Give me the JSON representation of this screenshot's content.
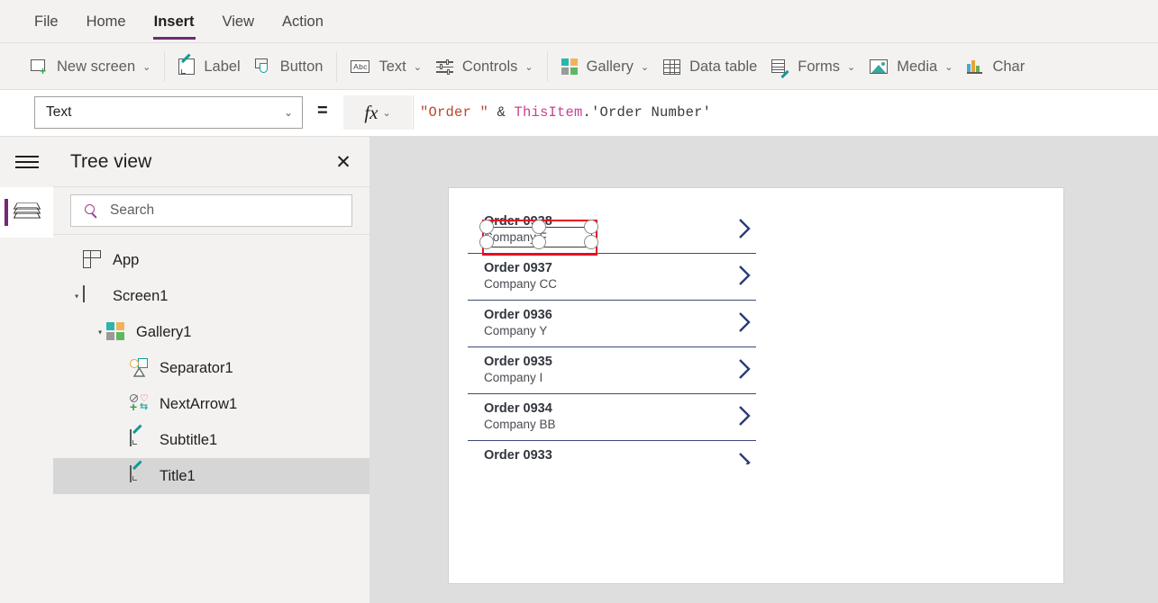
{
  "menubar": {
    "items": [
      {
        "label": "File",
        "active": false
      },
      {
        "label": "Home",
        "active": false
      },
      {
        "label": "Insert",
        "active": true
      },
      {
        "label": "View",
        "active": false
      },
      {
        "label": "Action",
        "active": false
      }
    ]
  },
  "ribbon": {
    "items": [
      {
        "label": "New screen",
        "icon": "new-screen-icon",
        "chevron": true
      },
      {
        "label": "Label",
        "icon": "label-pencil-icon",
        "chevron": false
      },
      {
        "label": "Button",
        "icon": "button-icon",
        "chevron": false
      },
      {
        "label": "Text",
        "icon": "abc-text-icon",
        "chevron": true
      },
      {
        "label": "Controls",
        "icon": "controls-sliders-icon",
        "chevron": true
      },
      {
        "label": "Gallery",
        "icon": "gallery-grid-icon",
        "chevron": true
      },
      {
        "label": "Data table",
        "icon": "data-table-icon",
        "chevron": false
      },
      {
        "label": "Forms",
        "icon": "forms-icon",
        "chevron": true
      },
      {
        "label": "Media",
        "icon": "media-image-icon",
        "chevron": true
      },
      {
        "label": "Char",
        "icon": "chart-bars-icon",
        "chevron": false
      }
    ],
    "chevron_glyph": "⌄"
  },
  "formula_bar": {
    "property": "Text",
    "property_chevron": "⌄",
    "equals": "=",
    "fx_label": "fx",
    "fx_chevron": "⌄",
    "formula_tokens": [
      {
        "text": "\"Order \"",
        "type": "string"
      },
      {
        "text": " & ",
        "type": "default"
      },
      {
        "text": "ThisItem",
        "type": "keyword"
      },
      {
        "text": ".'Order Number'",
        "type": "default"
      }
    ],
    "formula_plain": "\"Order \" & ThisItem.'Order Number'"
  },
  "rail": {
    "hamburger_name": "hamburger-menu-icon",
    "layers_name": "layers-tree-icon",
    "accent_color": "#742774"
  },
  "tree_panel": {
    "title": "Tree view",
    "close_glyph": "✕",
    "search": {
      "placeholder": "Search",
      "value": ""
    },
    "nodes": [
      {
        "label": "App",
        "icon": "app-icon",
        "indent": 0,
        "caret": "",
        "selected": false
      },
      {
        "label": "Screen1",
        "icon": "screen-icon",
        "indent": 0,
        "caret": "▸",
        "selected": false
      },
      {
        "label": "Gallery1",
        "icon": "gallery-icon",
        "indent": 1,
        "caret": "▸",
        "selected": false
      },
      {
        "label": "Separator1",
        "icon": "separator-icon",
        "indent": 2,
        "caret": "",
        "selected": false
      },
      {
        "label": "NextArrow1",
        "icon": "next-arrow-icon",
        "indent": 2,
        "caret": "",
        "selected": false
      },
      {
        "label": "Subtitle1",
        "icon": "label-icon",
        "indent": 2,
        "caret": "",
        "selected": false
      },
      {
        "label": "Title1",
        "icon": "label-icon",
        "indent": 2,
        "caret": "",
        "selected": true
      }
    ]
  },
  "canvas": {
    "background_color": "#dedede",
    "screen_background": "#ffffff",
    "gallery": {
      "selected_index": 0,
      "divider_color": "#3b4a78",
      "chevron_color": "#2b3a7a",
      "items": [
        {
          "title": "Order 0938",
          "subtitle": "Company F",
          "clipped": false
        },
        {
          "title": "Order 0937",
          "subtitle": "Company CC",
          "clipped": false
        },
        {
          "title": "Order 0936",
          "subtitle": "Company Y",
          "clipped": false
        },
        {
          "title": "Order 0935",
          "subtitle": "Company I",
          "clipped": false
        },
        {
          "title": "Order 0934",
          "subtitle": "Company BB",
          "clipped": false
        },
        {
          "title": "Order 0933",
          "subtitle": "",
          "clipped": true
        }
      ]
    },
    "selection": {
      "control": "Title1",
      "outline_color": "#e81123",
      "handle_count": 6
    }
  }
}
